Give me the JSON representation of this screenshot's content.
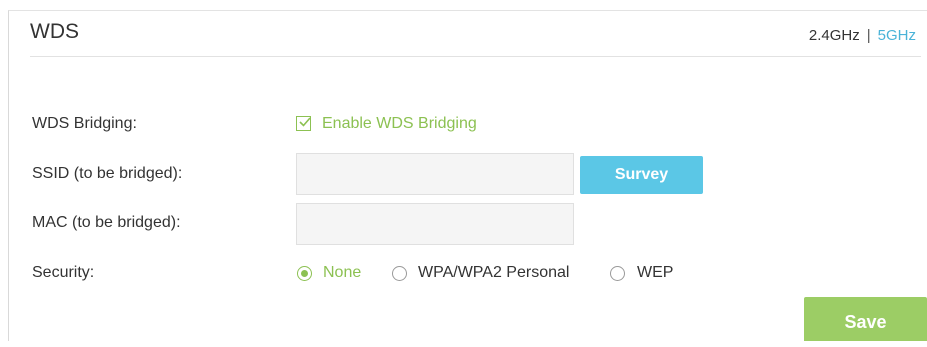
{
  "header": {
    "title": "WDS",
    "band_24": "2.4GHz",
    "separator": "|",
    "band_5": "5GHz"
  },
  "wds_bridging": {
    "label": "WDS Bridging:",
    "checkbox_label": "Enable WDS Bridging",
    "checked": true
  },
  "ssid": {
    "label": "SSID (to be bridged):",
    "value": "",
    "survey_label": "Survey"
  },
  "mac": {
    "label": "MAC (to be bridged):",
    "value": ""
  },
  "security": {
    "label": "Security:",
    "options": [
      {
        "label": "None",
        "selected": true
      },
      {
        "label": "WPA/WPA2 Personal",
        "selected": false
      },
      {
        "label": "WEP",
        "selected": false
      }
    ]
  },
  "actions": {
    "save_label": "Save"
  },
  "colors": {
    "accent_green": "#8cc152",
    "accent_blue": "#5bc7e6",
    "link_blue": "#4ab3d8",
    "save_green": "#9ccd65"
  },
  "icons": {
    "checkbox": "check-icon"
  }
}
